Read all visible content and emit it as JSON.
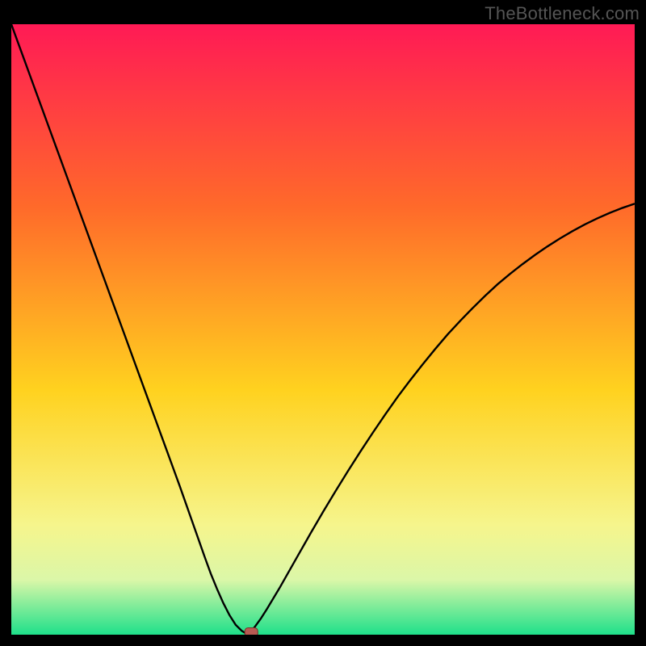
{
  "watermark": "TheBottleneck.com",
  "colors": {
    "frame_bg": "#000000",
    "gradient_top": "#ff1a55",
    "gradient_mid1": "#ff6a2a",
    "gradient_mid2": "#ffd21f",
    "gradient_low1": "#f6f58c",
    "gradient_low2": "#dbf7a8",
    "gradient_bottom": "#1ee08a",
    "curve": "#000000",
    "marker_fill": "#b85a52",
    "marker_stroke": "#7a2f28"
  },
  "chart_data": {
    "type": "line",
    "title": "",
    "xlabel": "",
    "ylabel": "",
    "xlim": [
      0,
      100
    ],
    "ylim": [
      0,
      100
    ],
    "x": [
      0,
      1,
      2,
      3,
      4,
      5,
      6,
      7,
      8,
      9,
      10,
      11,
      12,
      13,
      14,
      15,
      16,
      17,
      18,
      19,
      20,
      21,
      22,
      23,
      24,
      25,
      26,
      27,
      28,
      29,
      30,
      31,
      32,
      33,
      34,
      35,
      36,
      37,
      37.5,
      38,
      38.5,
      39,
      40,
      41,
      42,
      43,
      44,
      45,
      46,
      47,
      48,
      50,
      52,
      54,
      56,
      58,
      60,
      62,
      64,
      66,
      68,
      70,
      72,
      74,
      76,
      78,
      80,
      82,
      84,
      86,
      88,
      90,
      92,
      94,
      96,
      98,
      100
    ],
    "values": [
      100,
      97.2,
      94.4,
      91.6,
      88.8,
      86,
      83.2,
      80.4,
      77.6,
      74.8,
      72,
      69.2,
      66.4,
      63.6,
      60.8,
      58,
      55.2,
      52.4,
      49.6,
      46.8,
      44,
      41.2,
      38.4,
      35.6,
      32.8,
      30,
      27.2,
      24.4,
      21.5,
      18.6,
      15.7,
      12.8,
      10,
      7.5,
      5.2,
      3.2,
      1.6,
      0.6,
      0.3,
      0.3,
      0.6,
      1.2,
      2.6,
      4.2,
      5.9,
      7.6,
      9.4,
      11.2,
      13,
      14.8,
      16.6,
      20.1,
      23.5,
      26.8,
      30,
      33.1,
      36.1,
      39,
      41.7,
      44.3,
      46.8,
      49.2,
      51.4,
      53.5,
      55.5,
      57.4,
      59.1,
      60.7,
      62.2,
      63.6,
      64.9,
      66.1,
      67.2,
      68.2,
      69.1,
      69.9,
      70.6
    ],
    "marker": {
      "x": 38.5,
      "y": 0.4
    },
    "background_gradient": {
      "direction": "vertical",
      "stops": [
        [
          0,
          "#ff1a55"
        ],
        [
          30,
          "#ff6a2a"
        ],
        [
          60,
          "#ffd21f"
        ],
        [
          82,
          "#f6f58c"
        ],
        [
          91,
          "#dbf7a8"
        ],
        [
          100,
          "#1ee08a"
        ]
      ]
    }
  }
}
